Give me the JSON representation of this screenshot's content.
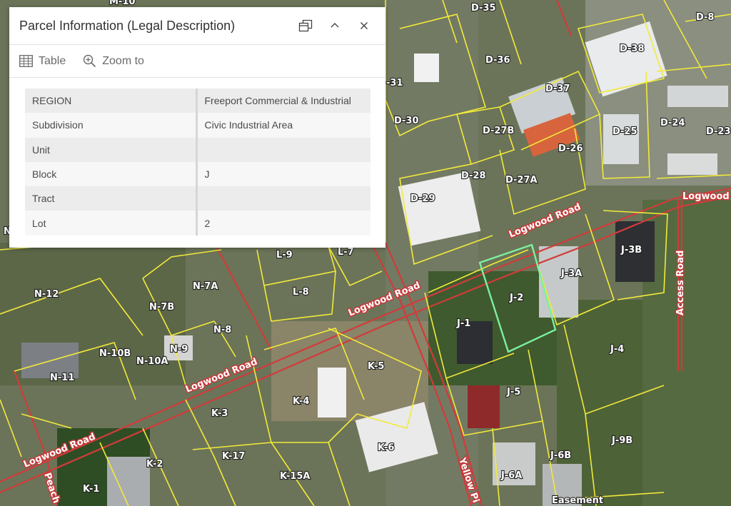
{
  "panel": {
    "title": "Parcel Information (Legal Description)",
    "actions": {
      "table_label": "Table",
      "zoom_label": "Zoom to"
    },
    "attributes": [
      {
        "key": "REGION",
        "value": "Freeport Commercial & Industrial"
      },
      {
        "key": "Subdivision",
        "value": "Civic Industrial Area"
      },
      {
        "key": "Unit",
        "value": ""
      },
      {
        "key": "Block",
        "value": "J"
      },
      {
        "key": "Tract",
        "value": ""
      },
      {
        "key": "Lot",
        "value": "2"
      }
    ]
  },
  "map": {
    "parcels": {
      "d35": "D-35",
      "d8": "D-8",
      "d36": "D-36",
      "d38": "D-38",
      "d31": "-31",
      "d37": "D-37",
      "d30": "D-30",
      "d27b": "D-27B",
      "d25": "D-25",
      "d24": "D-24",
      "d23": "D-23",
      "d26": "D-26",
      "d28": "D-28",
      "d27a": "D-27A",
      "d29": "D-29",
      "j3b": "J-3B",
      "j3a": "J-3A",
      "l9": "L-9",
      "l7": "L-7",
      "l8": "L-8",
      "n12": "N-12",
      "n7a": "N-7A",
      "n7b": "N-7B",
      "j2": "J-2",
      "j1": "J-1",
      "n8": "N-8",
      "n9": "N-9",
      "n10b": "N-10B",
      "n10a": "N-10A",
      "n11": "N-11",
      "j4": "J-4",
      "k5": "K-5",
      "k4": "K-4",
      "j5": "J-5",
      "k3": "K-3",
      "k6": "K-6",
      "j9b": "J-9B",
      "k17": "K-17",
      "j6b": "J-6B",
      "k2": "K-2",
      "k15a": "K-15A",
      "j6a": "J-6A",
      "k1": "K-1",
      "easement": "Easement",
      "m10": "M-10",
      "n_edge": "N"
    },
    "roads": {
      "logwood_1": "Logwood Road",
      "logwood_2": "Logwood Road",
      "logwood_3": "Logwood Road",
      "logwood_4": "Logwood Road",
      "logwood_5": "Logwood",
      "access": "Access Road",
      "yellow_pine": "Yellow Pi",
      "peach": "Peach"
    },
    "colors": {
      "parcel_line": "#f2ea3a",
      "road_line": "#d23b3b",
      "selected_parcel": "#7cf0a0"
    }
  }
}
